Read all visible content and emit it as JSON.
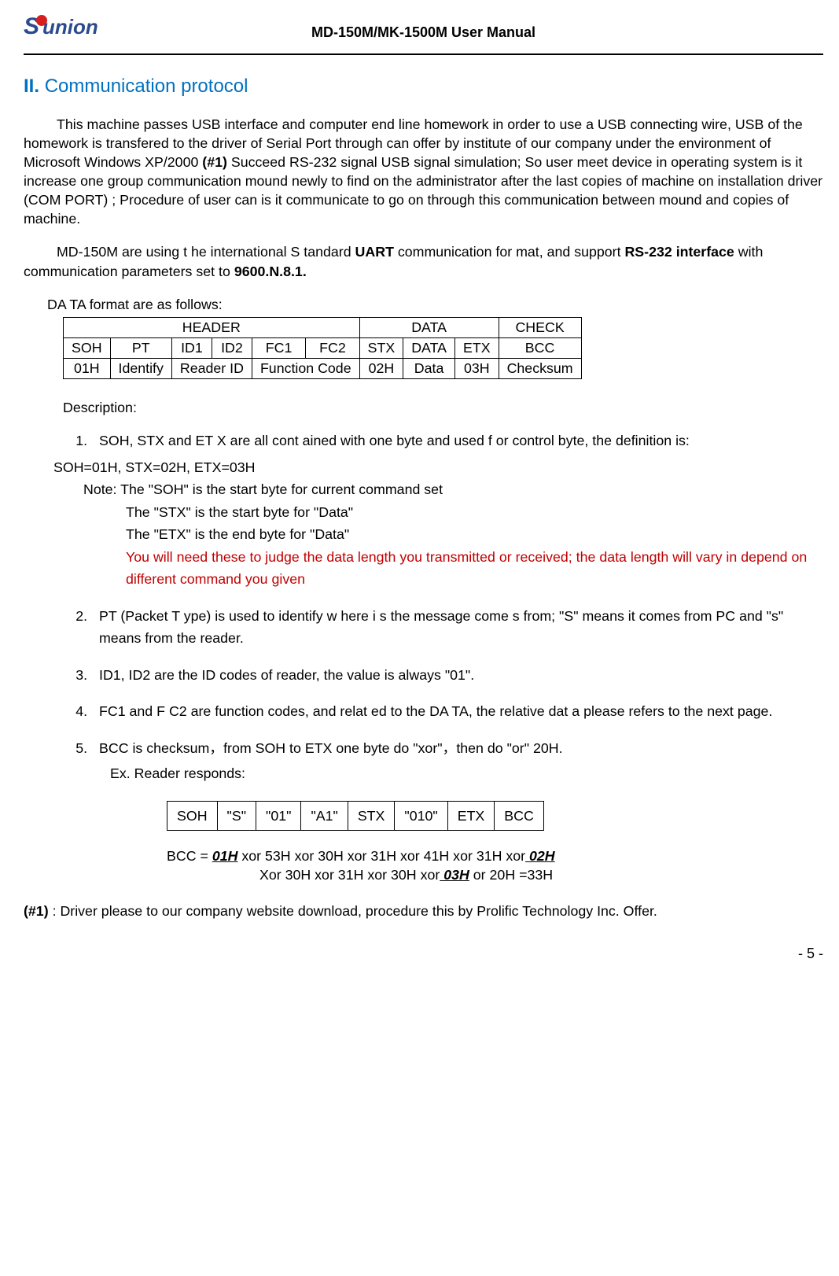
{
  "header": {
    "logo_s": "S",
    "logo_union": "union",
    "title": "MD-150M/MK-1500M User Manual"
  },
  "heading": {
    "roman": "II.",
    "text": "Communication protocol"
  },
  "paragraph1": "This machine passes USB interface and computer end line homework in order to use a USB connecting wire, USB of the homework is transfered to the driver of Serial Port through can offer by institute of our company under the environment of Microsoft Windows XP/2000 ",
  "paragraph1_bold": "(#1)",
  "paragraph1b": " Succeed RS-232 signal USB signal simulation; So user meet device in operating system is it increase one group communication mound newly to find on the administrator after the last copies of machine on installation driver (COM PORT) ; Procedure of user can is it communicate to go on through this communication between mound and copies of machine.",
  "paragraph2_a": "MD-150M are using t  he international S tandard ",
  "paragraph2_uart": "UART",
  "paragraph2_b": " communication for mat, and support ",
  "paragraph2_rs": "RS-232 interface",
  "paragraph2_c": " with communication parameters set to ",
  "paragraph2_params": "9600.N.8.1.",
  "format_label": "DA    TA format are as follows:",
  "table1": {
    "row1": [
      "HEADER",
      "DATA",
      "CHECK"
    ],
    "row2": [
      "SOH",
      "PT",
      "ID1",
      "ID2",
      "FC1",
      "FC2",
      "STX",
      "DATA",
      "ETX",
      "BCC"
    ],
    "row3": [
      "01H",
      "Identify",
      "Reader ID",
      "Function Code",
      "02H",
      "Data",
      "03H",
      "Checksum"
    ]
  },
  "description_label": "Description:",
  "items": {
    "1a": "SOH, STX and ET  X are all cont  ained with  one byte and used f    or control byte, the definition is:",
    "1b": "SOH=01H,    STX=02H, ETX=03H",
    "1c": "Note: The \"SOH\" is the start byte for current command set",
    "1d": "The \"STX\" is the start byte for \"Data\"",
    "1e": "The \"ETX\" is the end byte for \"Data\"",
    "1f": "You will need these to judge the data length you transmitted or received;  the data length will vary in depend on different command you given",
    "2": "PT (Packet T ype) is used to identify w  here i s the message come s from; \"S\" means it comes from PC and \"s\" means from the reader.",
    "3": "ID1, ID2 are the ID codes of reader, the value is always \"01\".",
    "4": "FC1 and F C2 are function codes, and relat   ed to the DA TA, the relative dat  a please refers to the next page.",
    "5": "BCC is checksum，from SOH to ETX one byte do \"xor\"，then do \"or\" 20H.",
    "5ex": "Ex. Reader responds:"
  },
  "example_table": [
    "SOH",
    "\"S\"",
    "\"01\"",
    "\"A1\"",
    "STX",
    "\"010\"",
    "ETX",
    "BCC"
  ],
  "bcc": {
    "prefix": "BCC = ",
    "h01": "01H",
    "mid1": " xor 53H xor 30H xor 31H xor 41H xor 31H xor",
    "h02": " 02H",
    "line2a": "Xor 30H xor 31H xor 30H xor",
    "h03": " 03H",
    "line2b": " or 20H =33H"
  },
  "footer": {
    "bold": "(#1)",
    "text": " : Driver please to our company website download, procedure this by Prolific Technology Inc. Offer."
  },
  "page_number": "- 5 -"
}
